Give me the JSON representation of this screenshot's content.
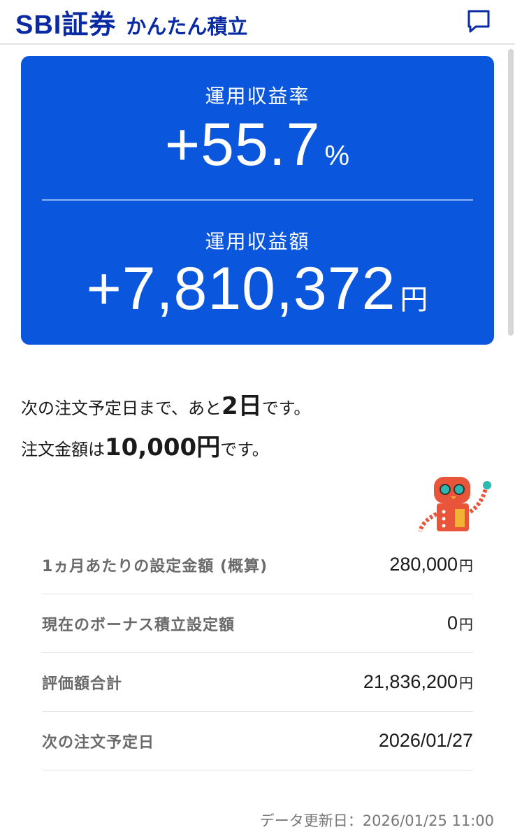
{
  "header": {
    "brand": "SBI証券",
    "subtitle": "かんたん積立",
    "chat_icon": "chat-bubble-icon"
  },
  "summary": {
    "rate_label": "運用収益率",
    "rate_value": "+55.7",
    "rate_unit": "%",
    "amount_label": "運用収益額",
    "amount_value": "+7,810,372",
    "amount_unit": "円",
    "card_color": "#0a57dd"
  },
  "next_order": {
    "line1_prefix": "次の注文予定日まで、あと",
    "days": "2日",
    "line1_suffix": "です。",
    "line2_prefix": "注文金額は",
    "amount": "10,000円",
    "line2_suffix": "です。"
  },
  "info": {
    "rows": [
      {
        "label": "1ヵ月あたりの設定金額 (概算)",
        "value": "280,000",
        "unit": "円"
      },
      {
        "label": "現在のボーナス積立設定額",
        "value": "0",
        "unit": "円"
      },
      {
        "label": "評価額合計",
        "value": "21,836,200",
        "unit": "円"
      },
      {
        "label": "次の注文予定日",
        "value": "2026/01/27",
        "unit": ""
      }
    ]
  },
  "footer": {
    "updated": "データ更新日：2026/01/25 11:00"
  },
  "colors": {
    "brand": "#0a2aa4",
    "accent": "#0a57dd",
    "robot_body": "#e8553a"
  }
}
